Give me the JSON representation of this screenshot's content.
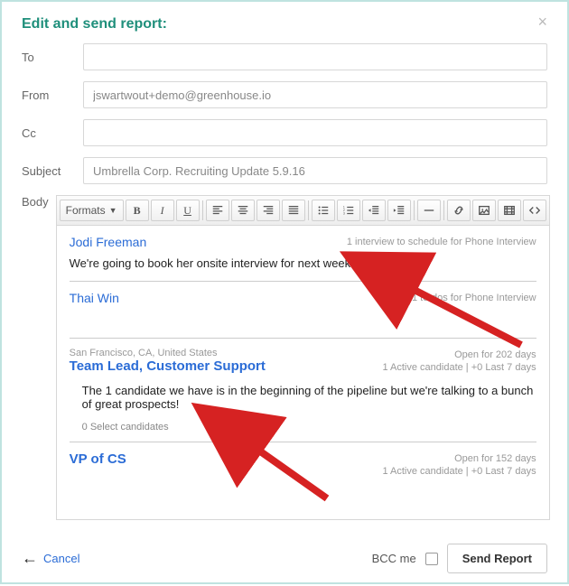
{
  "modal": {
    "title": "Edit and send report:",
    "close": "×"
  },
  "fields": {
    "to_label": "To",
    "to_value": "",
    "from_label": "From",
    "from_value": "jswartwout+demo@greenhouse.io",
    "cc_label": "Cc",
    "cc_value": "",
    "subject_label": "Subject",
    "subject_value": "Umbrella Corp. Recruiting Update 5.9.16",
    "body_label": "Body"
  },
  "toolbar": {
    "formats": "Formats"
  },
  "body_content": {
    "cand1_name": "Jodi Freeman",
    "cand1_meta": "1 interview to schedule for Phone Interview",
    "cand1_note": "We're going to book her onsite interview for next week!",
    "cand2_name": "Thai Win",
    "cand2_meta": "1 to-dos for Phone Interview",
    "job1_loc": "San Francisco, CA, United States",
    "job1_title": "Team Lead, Customer Support",
    "job1_meta1": "Open for 202 days",
    "job1_meta2": "1 Active candidate | +0 Last 7 days",
    "job1_note": "The 1 candidate we have is in the beginning of the pipeline but we're talking to a bunch of great prospects!",
    "job1_sel": "0 Select candidates",
    "job2_title": "VP of CS",
    "job2_meta1": "Open for 152 days",
    "job2_meta2": "1 Active candidate | +0 Last 7 days"
  },
  "footer": {
    "cancel": "Cancel",
    "bcc_label": "BCC me",
    "send": "Send Report"
  }
}
